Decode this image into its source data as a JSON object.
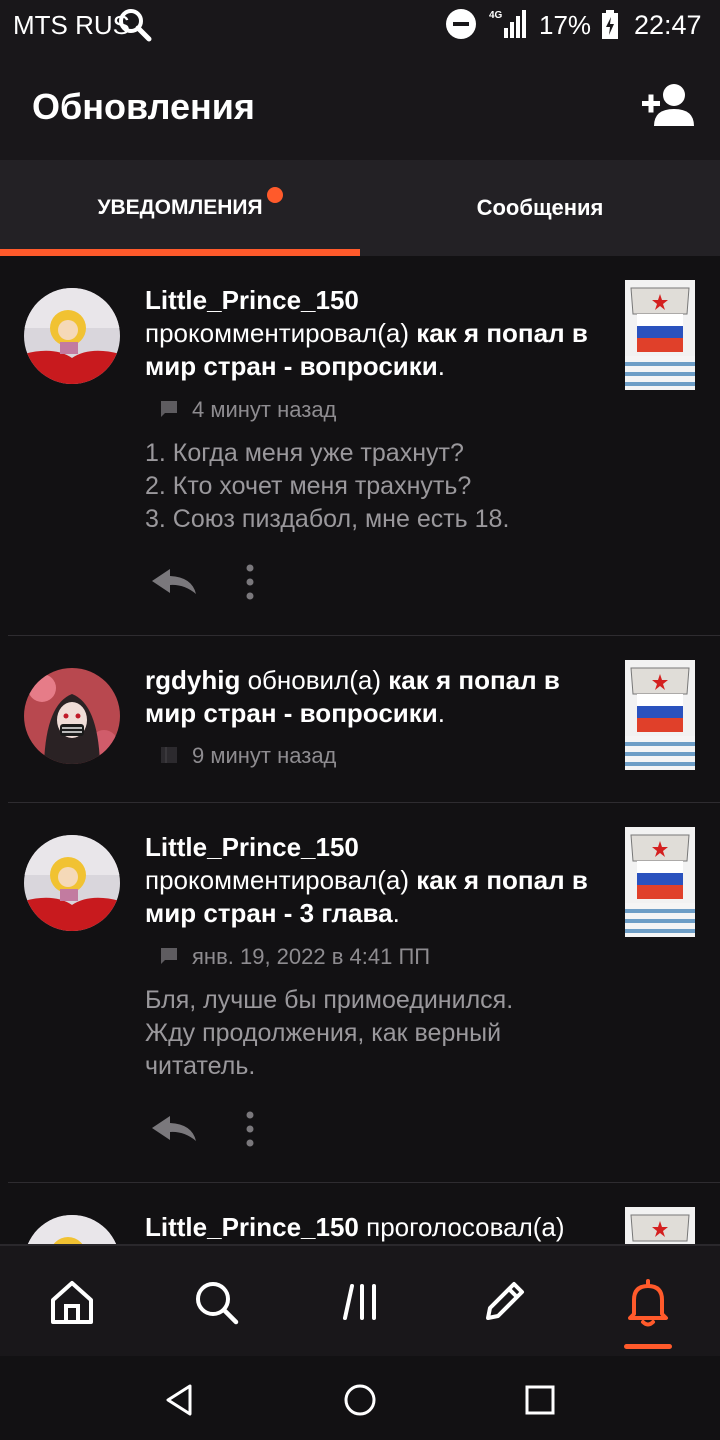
{
  "status_bar": {
    "carrier": "MTS RUS",
    "network": "4G",
    "battery": "17%",
    "time": "22:47",
    "icons": [
      "search-icon",
      "do-not-disturb-icon",
      "signal-icon",
      "battery-charging-icon"
    ]
  },
  "header": {
    "title": "Обновления",
    "action_icon": "add-user-icon"
  },
  "tabs": [
    {
      "label": "УВЕДОМЛЕНИЯ",
      "active": true,
      "has_badge": true
    },
    {
      "label": "Сообщения",
      "active": false,
      "has_badge": false
    }
  ],
  "colors": {
    "accent": "#ff5a2b",
    "background": "#121113",
    "surface": "#19171a",
    "muted_text": "#8e8c90"
  },
  "notifications": [
    {
      "user": "Little_Prince_150",
      "action": "прокомментировал(а)",
      "story": "как я попал в мир стран - вопросики",
      "punct": ".",
      "time": "4 минут назад",
      "meta_icon": "comment-icon",
      "comment_lines": [
        "1. Когда меня уже трахнут?",
        "2. Кто хочет меня трахнуть?",
        "3. Союз пиздабол, мне есть 18."
      ]
    },
    {
      "user": "rgdyhig",
      "action": "обновил(а)",
      "story": "как я попал в мир стран - вопросики",
      "punct": ".",
      "time": "9 минут назад",
      "meta_icon": "book-icon"
    },
    {
      "user": "Little_Prince_150",
      "action": "прокомментировал(а)",
      "story": "как я попал в мир стран - 3 глава",
      "punct": ".",
      "time": "янв. 19, 2022 в 4:41 ПП",
      "meta_icon": "comment-icon",
      "comment_lines": [
        "Бля, лучше бы примоединился.",
        "Жду продолжения, как верный",
        "читатель."
      ]
    },
    {
      "user": "Little_Prince_150",
      "action": "проголосовал(а)"
    }
  ],
  "bottom_nav": [
    {
      "icon": "home-icon",
      "active": false
    },
    {
      "icon": "search-icon",
      "active": false
    },
    {
      "icon": "library-icon",
      "active": false
    },
    {
      "icon": "write-icon",
      "active": false
    },
    {
      "icon": "notifications-bell-icon",
      "active": true
    }
  ],
  "system_nav": [
    "back-icon",
    "home-circle-icon",
    "recents-icon"
  ]
}
